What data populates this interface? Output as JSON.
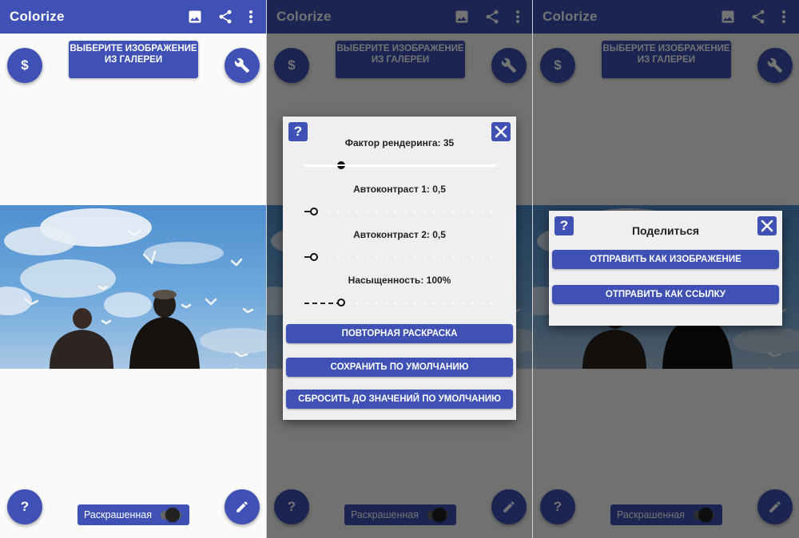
{
  "app": {
    "title": "Colorize",
    "gallery_button": "ВЫБЕРИТЕ ИЗОБРАЖЕНИЕ ИЗ ГАЛЕРЕИ",
    "colored_toggle_label": "Раскрашенная",
    "colored_toggle_on": true,
    "help_symbol": "?",
    "dollar_symbol": "$"
  },
  "icons": {
    "image": "image-icon",
    "share": "share-icon",
    "more": "more-vert-icon",
    "dollar": "dollar-icon",
    "wrench": "wrench-icon",
    "help": "help-icon",
    "edit": "pencil-icon",
    "close": "close-icon"
  },
  "colors": {
    "primary": "#3f51b5",
    "dialog_bg": "#efefef",
    "overlay": "rgba(0,0,0,0.55)"
  },
  "settings_dialog": {
    "sliders": [
      {
        "label": "Фактор рендеринга: 35",
        "value": 35,
        "fraction": 0.19,
        "style": "solid"
      },
      {
        "label": "Автоконтраст 1: 0,5",
        "value": 0.5,
        "fraction": 0.05,
        "style": "dotted"
      },
      {
        "label": "Автоконтраст 2: 0,5",
        "value": 0.5,
        "fraction": 0.05,
        "style": "dotted"
      },
      {
        "label": "Насыщенность: 100%",
        "value": 100,
        "fraction": 0.19,
        "style": "dashed"
      }
    ],
    "buttons": [
      "ПОВТОРНАЯ РАСКРАСКА",
      "СОХРАНИТЬ ПО УМОЛЧАНИЮ",
      "СБРОСИТЬ ДО ЗНАЧЕНИЙ ПО УМОЛЧАНИЮ"
    ]
  },
  "share_dialog": {
    "title": "Поделиться",
    "buttons": [
      "ОТПРАВИТЬ КАК ИЗОБРАЖЕНИЕ",
      "ОТПРАВИТЬ КАК ССЫЛКУ"
    ]
  }
}
